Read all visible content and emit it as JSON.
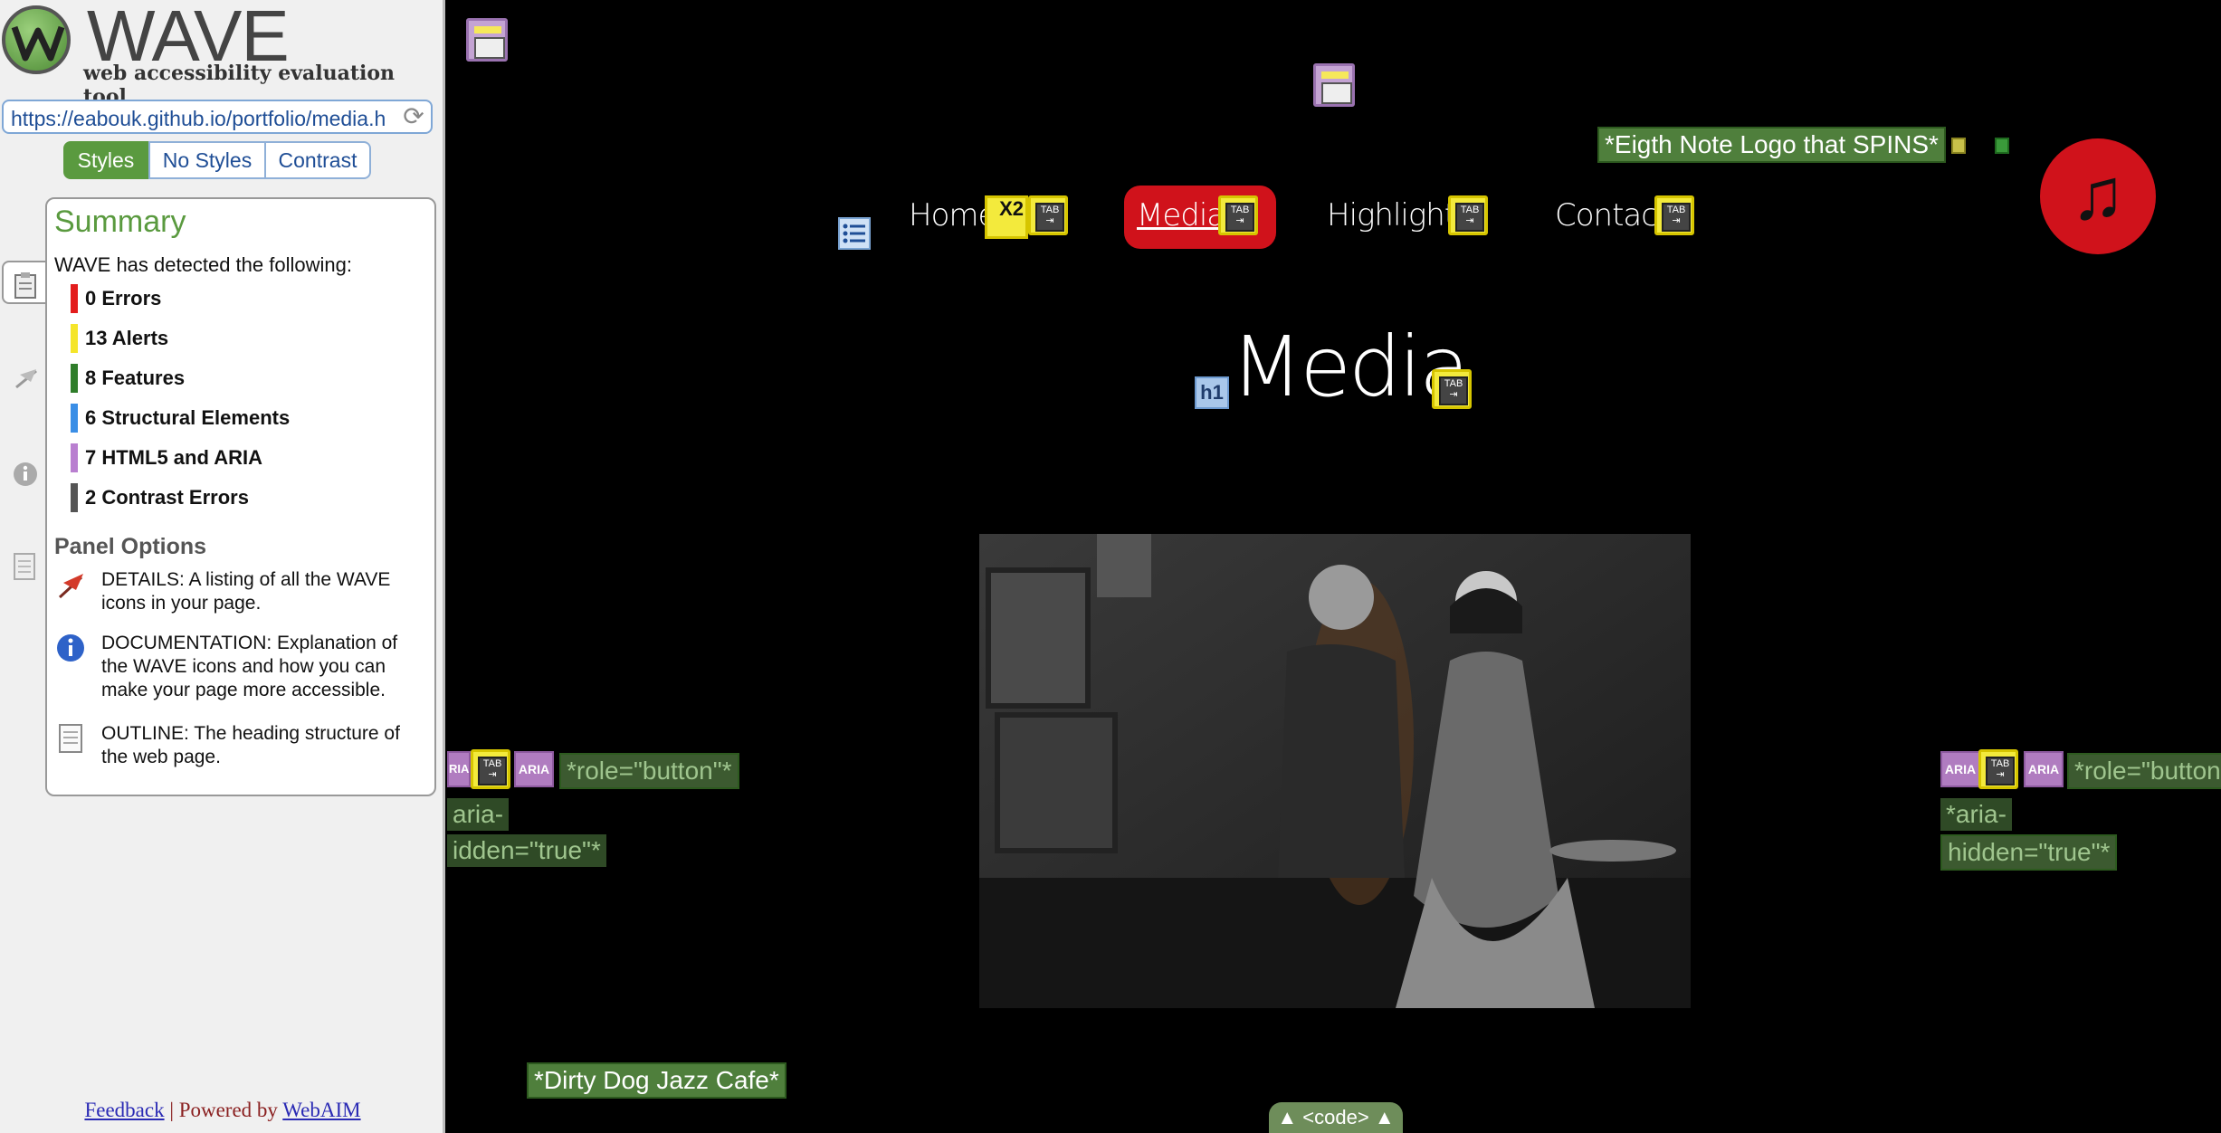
{
  "wave": {
    "logo_title": "WAVE",
    "logo_subtitle": "web accessibility evaluation tool",
    "url": "https://eabouk.github.io/portfolio/media.h",
    "view_tabs": [
      "Styles",
      "No Styles",
      "Contrast"
    ],
    "summary": {
      "title": "Summary",
      "intro": "WAVE has detected the following:",
      "items": [
        {
          "label": "0 Errors",
          "color": "#e31c1c"
        },
        {
          "label": "13 Alerts",
          "color": "#f5e52a"
        },
        {
          "label": "8 Features",
          "color": "#2f7d2a"
        },
        {
          "label": "6 Structural Elements",
          "color": "#3a8ee6"
        },
        {
          "label": "7 HTML5 and ARIA",
          "color": "#b97fd0"
        },
        {
          "label": "2 Contrast Errors",
          "color": "#555555"
        }
      ]
    },
    "panel_options": {
      "title": "Panel Options",
      "items": [
        {
          "icon": "details-flag-icon",
          "text": "DETAILS: A listing of all the WAVE icons in your page."
        },
        {
          "icon": "info-icon",
          "text": "DOCUMENTATION: Explanation of the WAVE icons and how you can make your page more accessible."
        },
        {
          "icon": "outline-document-icon",
          "text": "OUTLINE: The heading structure of the web page."
        }
      ]
    },
    "footer": {
      "feedback": "Feedback",
      "separator": "|",
      "powered": "Powered by",
      "webaim": "WebAIM"
    }
  },
  "page": {
    "nav": [
      "Home",
      "Media",
      "Highlights",
      "Contact"
    ],
    "nav_x2": "X2",
    "logo_label": "*Eigth Note Logo that SPINS*",
    "logo_glyph": "♫",
    "heading": "Media",
    "h1_icon": "h1",
    "role_button": "*role=\"button\"*",
    "aria_hidden_1": "*aria-",
    "aria_hidden_2": "hidden=\"true\"*",
    "aria_hidden_left_1": "aria-",
    "aria_hidden_left_2": "idden=\"true\"*",
    "aria_label": "ARIA",
    "aria_label_left": "RIA",
    "photo_alt": "*Dirty Dog Jazz Cafe*",
    "code_tab": "<code>"
  }
}
